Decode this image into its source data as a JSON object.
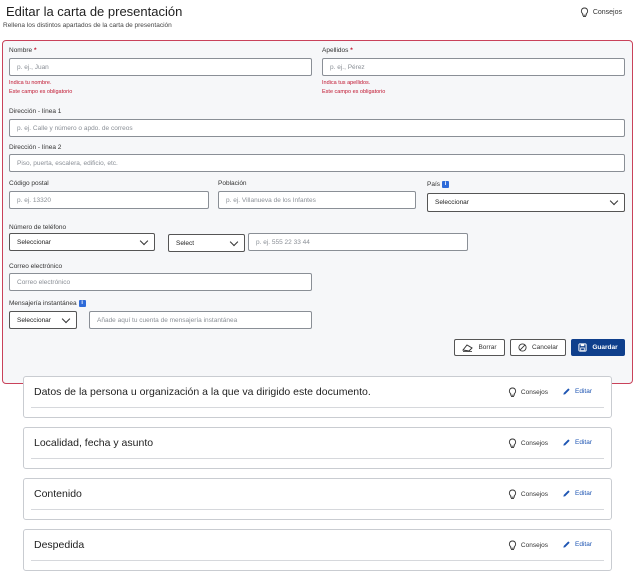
{
  "header": {
    "title": "Editar la carta de presentación",
    "subtitle": "Rellena los distintos apartados de la carta de presentación",
    "tips_label": "Consejos"
  },
  "form": {
    "nombre": {
      "label": "Nombre",
      "required_mark": "*",
      "placeholder": "p. ej., Juan",
      "error_1": "Indica tu nombre.",
      "error_2": "Este campo es obligatorio"
    },
    "apellidos": {
      "label": "Apellidos",
      "required_mark": "*",
      "placeholder": "p. ej., Pérez",
      "error_1": "Indica tus apellidos.",
      "error_2": "Este campo es obligatorio"
    },
    "direccion1": {
      "label": "Dirección - línea 1",
      "placeholder": "p. ej. Calle y número o apdo. de correos"
    },
    "direccion2": {
      "label": "Dirección - línea 2",
      "placeholder": "Piso, puerta, escalera, edificio, etc."
    },
    "codigo_postal": {
      "label": "Código postal",
      "placeholder": "p. ej. 13320"
    },
    "poblacion": {
      "label": "Población",
      "placeholder": "p. ej. Villanueva de los Infantes"
    },
    "pais": {
      "label": "País",
      "info_icon": "info-icon",
      "value": "Seleccionar"
    },
    "telefono": {
      "label": "Número de teléfono",
      "type_value": "Seleccionar",
      "prefix_value": "Select",
      "placeholder": "p. ej. 555 22 33 44"
    },
    "correo": {
      "label": "Correo electrónico",
      "placeholder": "Correo electrónico"
    },
    "mensajeria": {
      "label": "Mensajería instantánea",
      "info_icon": "info-icon",
      "type_value": "Seleccionar",
      "placeholder": "Añade aquí tu cuenta de mensajería instantánea"
    },
    "buttons": {
      "clear": "Borrar",
      "cancel": "Cancelar",
      "save": "Guardar"
    }
  },
  "sections": [
    {
      "title": "Datos de la persona u organización a la que va dirigido este documento.",
      "tips": "Consejos",
      "edit": "Editar"
    },
    {
      "title": "Localidad, fecha y asunto",
      "tips": "Consejos",
      "edit": "Editar"
    },
    {
      "title": "Contenido",
      "tips": "Consejos",
      "edit": "Editar"
    },
    {
      "title": "Despedida",
      "tips": "Consejos",
      "edit": "Editar"
    }
  ],
  "colors": {
    "accent": "#0f3f8c",
    "error": "#c0152f",
    "link": "#1e55b3",
    "card_border": "#c9425a"
  }
}
